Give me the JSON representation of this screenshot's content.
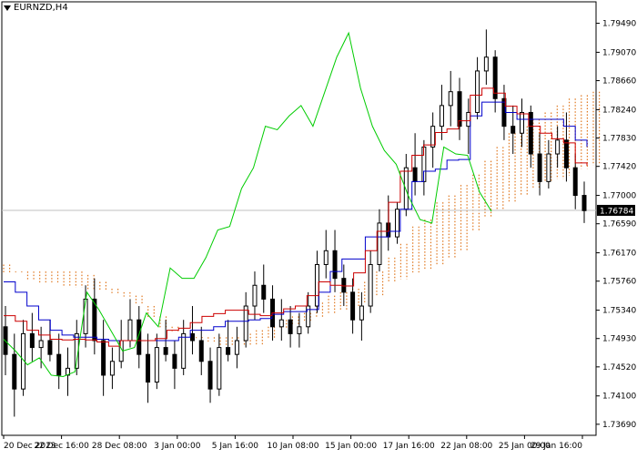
{
  "chart_data": {
    "type": "candlestick",
    "title": "EURNZD,H4",
    "current_price": "1.76784",
    "ylim": [
      1.7353,
      1.798
    ],
    "y_ticks": [
      "1.79490",
      "1.79070",
      "1.78660",
      "1.78240",
      "1.77830",
      "1.77420",
      "1.77000",
      "1.76590",
      "1.76170",
      "1.75760",
      "1.75340",
      "1.74930",
      "1.74520",
      "1.74100",
      "1.73690"
    ],
    "x_ticks": [
      "20 Dec 2023",
      "22 Dec 16:00",
      "28 Dec 08:00",
      "3 Jan 00:00",
      "5 Jan 16:00",
      "10 Jan 08:00",
      "15 Jan 00:00",
      "17 Jan 16:00",
      "22 Jan 08:00",
      "25 Jan 00:00",
      "29 Jan 16:00"
    ],
    "colors": {
      "candle": "#000000",
      "tenkan": "#cc0000",
      "kijun": "#0000cc",
      "chikou": "#00cc00",
      "cloud": "#e07820",
      "grid": "#c0c0c0"
    },
    "series": [
      {
        "name": "Tenkan-sen",
        "values": [
          1.7526,
          1.7518,
          1.7505,
          1.7498,
          1.7492,
          1.7491,
          1.7492,
          1.7491,
          1.7488,
          1.7482,
          1.749,
          1.749,
          1.749,
          1.7493,
          1.7505,
          1.7508,
          1.7516,
          1.7525,
          1.7529,
          1.7534,
          1.7534,
          1.7528,
          1.7526,
          1.753,
          1.7536,
          1.754,
          1.7555,
          1.7575,
          1.757,
          1.7569,
          1.7588,
          1.762,
          1.7648,
          1.769,
          1.7735,
          1.7758,
          1.7773,
          1.7791,
          1.7796,
          1.7808,
          1.7845,
          1.7855,
          1.7848,
          1.7829,
          1.7818,
          1.78,
          1.779,
          1.7782,
          1.7776,
          1.7747,
          1.7743
        ]
      },
      {
        "name": "Kijun-sen",
        "values": [
          1.7575,
          1.756,
          1.754,
          1.752,
          1.7505,
          1.7498,
          1.7495,
          1.7495,
          1.7492,
          1.749,
          1.749,
          1.749,
          1.749,
          1.749,
          1.749,
          1.7495,
          1.7505,
          1.7505,
          1.751,
          1.7518,
          1.7518,
          1.752,
          1.7522,
          1.7528,
          1.7532,
          1.7532,
          1.7535,
          1.756,
          1.759,
          1.7608,
          1.7608,
          1.764,
          1.764,
          1.7648,
          1.768,
          1.772,
          1.7735,
          1.7738,
          1.7751,
          1.7752,
          1.7815,
          1.7835,
          1.7835,
          1.782,
          1.781,
          1.781,
          1.781,
          1.781,
          1.78,
          1.778,
          1.777
        ]
      },
      {
        "name": "Chikou Span",
        "values": [
          1.7492,
          1.7475,
          1.7455,
          1.7465,
          1.744,
          1.7438,
          1.7445,
          1.756,
          1.7535,
          1.7505,
          1.7475,
          1.748,
          1.753,
          1.751,
          1.7595,
          1.758,
          1.758,
          1.761,
          1.765,
          1.7655,
          1.771,
          1.774,
          1.78,
          1.7795,
          1.7815,
          1.783,
          1.78,
          1.785,
          1.79,
          1.7935,
          1.7855,
          1.78,
          1.7765,
          1.7745,
          1.77,
          1.7665,
          1.766,
          1.777,
          1.776,
          1.7758,
          1.7705,
          1.7677
        ]
      },
      {
        "name": "Senkou A",
        "values": [
          1.76,
          1.759,
          1.758,
          1.7575,
          1.7575,
          1.757,
          1.7568,
          1.7565,
          1.7565,
          1.756,
          1.756,
          1.7555,
          1.754,
          1.7525,
          1.751,
          1.75,
          1.7495,
          1.7495,
          1.7495,
          1.7495,
          1.75,
          1.7505,
          1.751,
          1.752,
          1.7525,
          1.753,
          1.7545,
          1.7555,
          1.756,
          1.7565,
          1.7575,
          1.759,
          1.761,
          1.763,
          1.7655,
          1.7665,
          1.769,
          1.77,
          1.7715,
          1.773,
          1.775,
          1.777,
          1.779,
          1.78,
          1.781,
          1.782,
          1.783,
          1.784,
          1.7845,
          1.785
        ]
      },
      {
        "name": "Senkou B",
        "values": [
          1.759,
          1.759,
          1.759,
          1.759,
          1.759,
          1.759,
          1.759,
          1.7585,
          1.7575,
          1.7565,
          1.7555,
          1.7545,
          1.7525,
          1.751,
          1.7505,
          1.75,
          1.7495,
          1.749,
          1.7485,
          1.7485,
          1.7485,
          1.7485,
          1.7495,
          1.751,
          1.7515,
          1.752,
          1.7525,
          1.753,
          1.7535,
          1.754,
          1.7545,
          1.7555,
          1.7575,
          1.758,
          1.759,
          1.7595,
          1.76,
          1.761,
          1.762,
          1.765,
          1.767,
          1.768,
          1.769,
          1.77,
          1.771,
          1.772,
          1.7725,
          1.773,
          1.774,
          1.7745
        ]
      }
    ],
    "candles_ohlc": [
      [
        1.751,
        1.754,
        1.744,
        1.747
      ],
      [
        1.747,
        1.75,
        1.738,
        1.742
      ],
      [
        1.742,
        1.752,
        1.741,
        1.75
      ],
      [
        1.75,
        1.753,
        1.746,
        1.748
      ],
      [
        1.748,
        1.751,
        1.745,
        1.749
      ],
      [
        1.749,
        1.752,
        1.746,
        1.747
      ],
      [
        1.747,
        1.75,
        1.742,
        1.744
      ],
      [
        1.744,
        1.748,
        1.741,
        1.745
      ],
      [
        1.745,
        1.752,
        1.744,
        1.75
      ],
      [
        1.75,
        1.757,
        1.748,
        1.755
      ],
      [
        1.755,
        1.758,
        1.747,
        1.749
      ],
      [
        1.749,
        1.752,
        1.741,
        1.744
      ],
      [
        1.744,
        1.748,
        1.742,
        1.746
      ],
      [
        1.746,
        1.752,
        1.745,
        1.749
      ],
      [
        1.749,
        1.755,
        1.748,
        1.752
      ],
      [
        1.752,
        1.754,
        1.745,
        1.747
      ],
      [
        1.747,
        1.75,
        1.74,
        1.743
      ],
      [
        1.743,
        1.75,
        1.742,
        1.748
      ],
      [
        1.748,
        1.752,
        1.746,
        1.747
      ],
      [
        1.747,
        1.749,
        1.742,
        1.745
      ],
      [
        1.745,
        1.752,
        1.744,
        1.75
      ],
      [
        1.75,
        1.754,
        1.747,
        1.749
      ],
      [
        1.749,
        1.751,
        1.744,
        1.746
      ],
      [
        1.746,
        1.748,
        1.74,
        1.742
      ],
      [
        1.742,
        1.75,
        1.741,
        1.748
      ],
      [
        1.748,
        1.752,
        1.746,
        1.747
      ],
      [
        1.747,
        1.751,
        1.745,
        1.749
      ],
      [
        1.749,
        1.756,
        1.748,
        1.754
      ],
      [
        1.754,
        1.759,
        1.752,
        1.757
      ],
      [
        1.757,
        1.76,
        1.753,
        1.755
      ],
      [
        1.755,
        1.757,
        1.749,
        1.751
      ],
      [
        1.751,
        1.755,
        1.749,
        1.752
      ],
      [
        1.752,
        1.754,
        1.748,
        1.75
      ],
      [
        1.75,
        1.753,
        1.748,
        1.751
      ],
      [
        1.751,
        1.756,
        1.75,
        1.754
      ],
      [
        1.754,
        1.762,
        1.753,
        1.76
      ],
      [
        1.76,
        1.765,
        1.758,
        1.762
      ],
      [
        1.762,
        1.765,
        1.756,
        1.758
      ],
      [
        1.758,
        1.76,
        1.754,
        1.756
      ],
      [
        1.756,
        1.758,
        1.75,
        1.752
      ],
      [
        1.752,
        1.756,
        1.749,
        1.754
      ],
      [
        1.754,
        1.762,
        1.753,
        1.76
      ],
      [
        1.76,
        1.768,
        1.759,
        1.766
      ],
      [
        1.766,
        1.77,
        1.762,
        1.764
      ],
      [
        1.764,
        1.769,
        1.763,
        1.768
      ],
      [
        1.768,
        1.776,
        1.767,
        1.774
      ],
      [
        1.774,
        1.779,
        1.77,
        1.772
      ],
      [
        1.772,
        1.778,
        1.77,
        1.777
      ],
      [
        1.777,
        1.782,
        1.774,
        1.78
      ],
      [
        1.78,
        1.786,
        1.778,
        1.783
      ],
      [
        1.783,
        1.788,
        1.78,
        1.785
      ],
      [
        1.785,
        1.787,
        1.778,
        1.78
      ],
      [
        1.78,
        1.784,
        1.776,
        1.782
      ],
      [
        1.782,
        1.79,
        1.781,
        1.788
      ],
      [
        1.788,
        1.794,
        1.786,
        1.79
      ],
      [
        1.79,
        1.791,
        1.782,
        1.784
      ],
      [
        1.784,
        1.786,
        1.778,
        1.78
      ],
      [
        1.78,
        1.783,
        1.776,
        1.779
      ],
      [
        1.779,
        1.784,
        1.777,
        1.782
      ],
      [
        1.782,
        1.783,
        1.774,
        1.776
      ],
      [
        1.776,
        1.779,
        1.77,
        1.772
      ],
      [
        1.772,
        1.778,
        1.771,
        1.776
      ],
      [
        1.776,
        1.78,
        1.774,
        1.778
      ],
      [
        1.778,
        1.782,
        1.772,
        1.774
      ],
      [
        1.774,
        1.776,
        1.768,
        1.77
      ],
      [
        1.77,
        1.772,
        1.766,
        1.7678
      ]
    ]
  }
}
